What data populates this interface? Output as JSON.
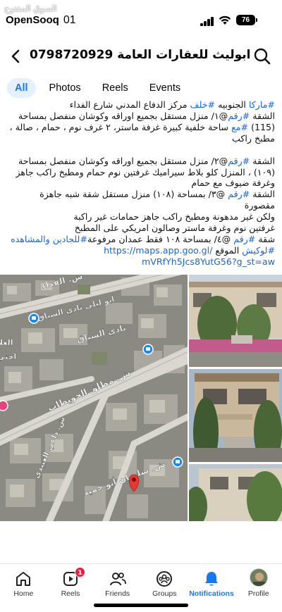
{
  "status_bar": {
    "watermark": "السوق المفتوح",
    "carrier": "OpenSooq",
    "time": "01",
    "battery": "76"
  },
  "header": {
    "title": "ابوليث للعقارات العامة 0798720929"
  },
  "tabs": [
    {
      "label": "All",
      "active": true
    },
    {
      "label": "Photos",
      "active": false
    },
    {
      "label": "Reels",
      "active": false
    },
    {
      "label": "Events",
      "active": false
    }
  ],
  "post": {
    "line1_tag1": "#ماركا",
    "line1_text1": " الجنوبيه ",
    "line1_tag2": "#خلف",
    "line1_text2": " مركز الدفاع المدني شارع الفداء",
    "line2_text1": "الشقة ",
    "line2_tag": "#رقم",
    "line2_text2": "@١/ منزل مستقل بجميع اوراقه وكوشان منفصل بمساحة",
    "line3_text1": "(115) ",
    "line3_tag": "#مع",
    "line3_text2": " ساحة خلفية كبيرة   غرفة ماستر، ٢ غرف نوم ، حمام ، صالة ،",
    "line4": "مطبخ راكب",
    "line5_text1": "الشقة ",
    "line5_tag": "#رقم",
    "line5_text2": "@٢/ منزل مستقل بجميع اوراقه وكوشان منفصل بمساحة",
    "line6": "(١٠٩) ، المنزل كلو بلاط سيراميك غرفتين نوم حمام ومطبخ راكب جاهز",
    "line7": "وغرفة ضيوف مع حمام",
    "line8_text1": "الشقة ",
    "line8_tag": "#رقم",
    "line8_text2": " @٣/ بمساحة (١٠٨) منزل مستقل شقة شبه جاهزة مقصورة",
    "line9": "ولكن غير مدهونة ومطبخ راكب جاهز حمامات غير راكبة",
    "line10": "غرفتين نوم وغرفة ماستر وصالون امريكي على المطبخ",
    "line11_text1": "شقة ",
    "line11_tag": "#رقم",
    "line11_text2": " @٤/ بمساحة ١٠٨ فقط عمدان مرفوعة",
    "line11_tag2": "#للجادين والمشاهده",
    "line12_tag": "#لوكيش",
    "line12_text": " الموقع ",
    "line12_link": "https://maps.app.goo.gl/",
    "line13_link": "mVRfYh5Jcs8YutG56?g_st=aw"
  },
  "map": {
    "street_1": "ش. الفداء",
    "place_1": "أبو ليلى نادي السباق",
    "place_2": "نادي السباق",
    "street_2": "ش. مطلق الحويطات",
    "street_3": "ش. سليمان أبو حميد",
    "street_4": "ش. داعي العبيدي",
    "edge_1": "العلا",
    "edge_2": "احتي"
  },
  "bottom_nav": [
    {
      "label": "Home",
      "icon": "home-icon",
      "active": false
    },
    {
      "label": "Reels",
      "icon": "reels-icon",
      "active": false,
      "badge": "1"
    },
    {
      "label": "Friends",
      "icon": "friends-icon",
      "active": false
    },
    {
      "label": "Groups",
      "icon": "groups-icon",
      "active": false
    },
    {
      "label": "Notifications",
      "icon": "bell-icon",
      "active": true
    },
    {
      "label": "Profile",
      "icon": "profile-picture",
      "active": false
    }
  ],
  "colors": {
    "accent": "#1877f2",
    "hashtag": "#1867d8",
    "badge": "#e41e3f",
    "tab_active_bg": "#e6f0ff"
  }
}
